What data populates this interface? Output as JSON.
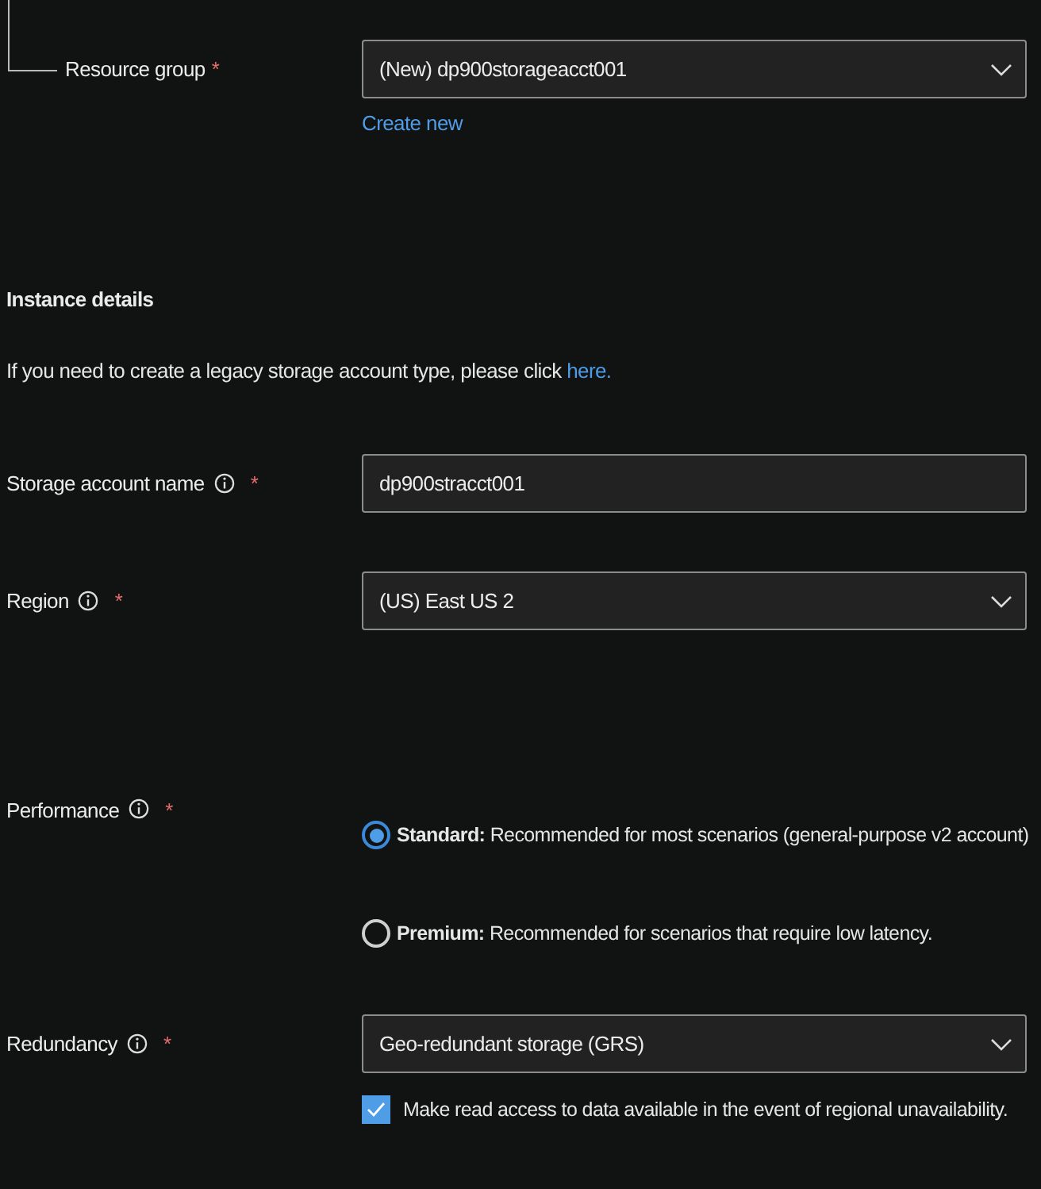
{
  "resource_group": {
    "label": "Resource group",
    "required": "*",
    "value": "(New) dp900storageacct001",
    "link": "Create new"
  },
  "section": {
    "title": "Instance details",
    "text": "If you need to create a legacy storage account type, please click ",
    "link": "here."
  },
  "fields": [
    {
      "kind": "text",
      "label": "Storage account name",
      "info": true,
      "required": "*",
      "value": "dp900stracct001"
    },
    {
      "kind": "select",
      "label": "Region",
      "info": true,
      "required": "*",
      "value": "(US) East US 2"
    },
    {
      "kind": "radio",
      "label": "Performance",
      "info": true,
      "required": "*",
      "options": [
        {
          "name": "Standard:",
          "text": " Recommended for most scenarios (general-purpose v2 account)",
          "selected": true
        },
        {
          "name": "Premium:",
          "text": " Recommended for scenarios that require low latency.",
          "selected": false
        }
      ]
    },
    {
      "kind": "select",
      "label": "Redundancy",
      "info": true,
      "required": "*",
      "value": "Geo-redundant storage (GRS)"
    }
  ],
  "checkbox": {
    "label": "Make read access to data available in the event of regional unavailability.",
    "checked": true
  }
}
